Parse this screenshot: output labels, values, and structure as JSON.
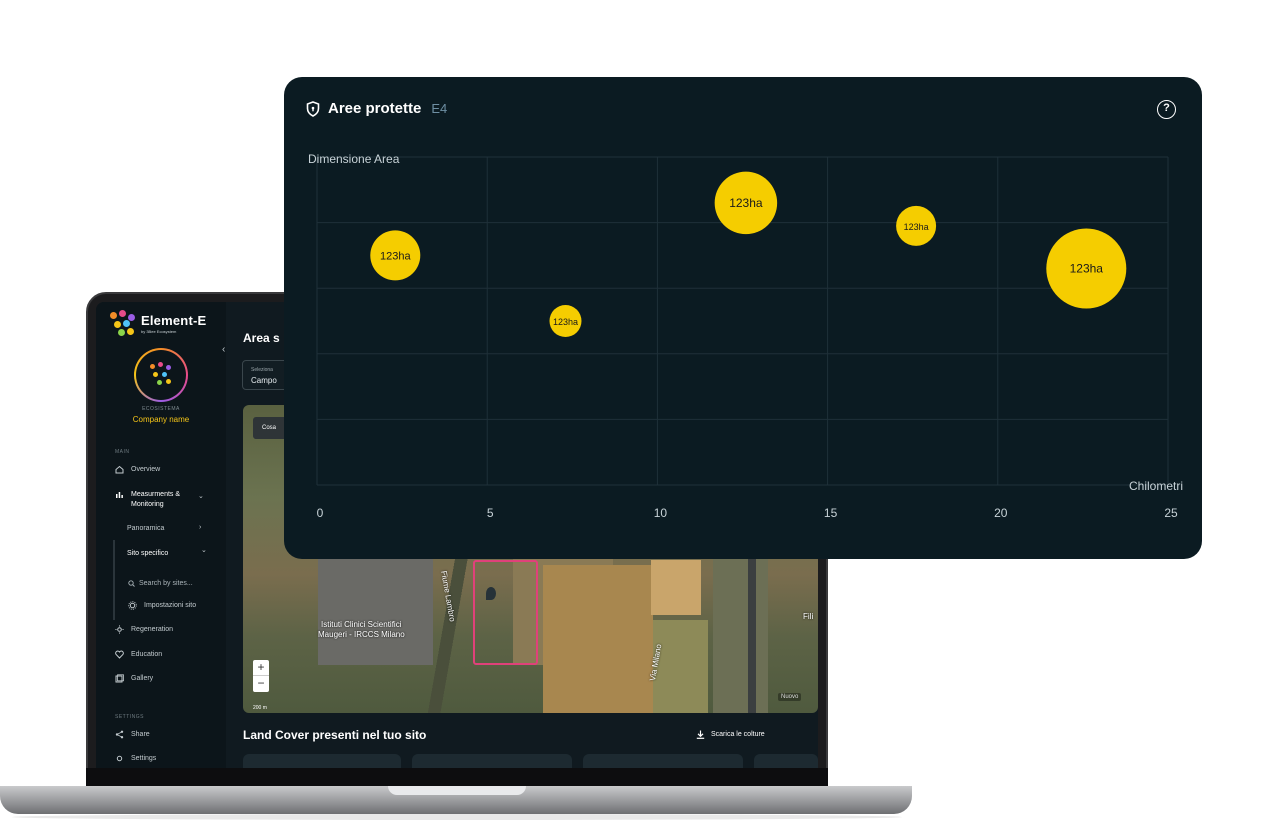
{
  "app": {
    "brand_name": "Element-E",
    "brand_sub": "by 3Bee Ecosystem",
    "eco_label": "ECOSISTEMA",
    "company_name": "Company name"
  },
  "sidebar": {
    "section_main": "MAIN",
    "section_settings": "SETTINGS",
    "items": [
      {
        "label": "Overview",
        "icon": "home-icon"
      },
      {
        "label": "Measurments & Monitoring",
        "icon": "bar-chart-icon"
      },
      {
        "label": "Regeneration",
        "icon": "sun-icon"
      },
      {
        "label": "Education",
        "icon": "heart-icon"
      },
      {
        "label": "Gallery",
        "icon": "gallery-icon"
      }
    ],
    "sub_items": {
      "panoramica": "Panoramica",
      "sito_specifico": "Sito specifico",
      "search": "Search by sites...",
      "impostazioni": "Impostazioni sito"
    },
    "settings_items": [
      {
        "label": "Share",
        "icon": "share-icon"
      },
      {
        "label": "Settings",
        "icon": "gear-icon"
      }
    ]
  },
  "main": {
    "title": "Area s",
    "field": {
      "label": "Seleziona",
      "value": "Campo"
    },
    "map": {
      "chip": "Cosa",
      "labels": [
        "Fiume Lambro",
        "Istituti Clinici Scientifici",
        "Maugeri - IRCCS Milano",
        "Via Milano",
        "Fili"
      ],
      "scale": "200 m",
      "badge": "Nuovo"
    },
    "landcover_title": "Land Cover presenti nel tuo sito",
    "download_label": "Scarica le colture"
  },
  "card": {
    "title": "Aree protette",
    "code": "E4",
    "help_icon": "question-icon",
    "shield_icon": "shield-icon"
  },
  "chart_data": {
    "type": "scatter",
    "title": "Aree protette",
    "ylabel": "Dimensione Area",
    "xlabel": "Chilometri",
    "xlim": [
      0,
      25
    ],
    "x_ticks": [
      "0",
      "5",
      "10",
      "15",
      "20",
      "25"
    ],
    "grid": true,
    "bubble_color": "#f5cd00",
    "points": [
      {
        "x": 2.3,
        "y": 0.7,
        "size": 1.0,
        "label": "123ha"
      },
      {
        "x": 7.3,
        "y": 0.5,
        "size": 0.64,
        "label": "123ha"
      },
      {
        "x": 12.6,
        "y": 0.86,
        "size": 1.25,
        "label": "123ha"
      },
      {
        "x": 17.6,
        "y": 0.79,
        "size": 0.8,
        "label": "123ha"
      },
      {
        "x": 22.6,
        "y": 0.66,
        "size": 1.6,
        "label": "123ha"
      }
    ]
  },
  "colors": {
    "accent": "#f5cd00",
    "card_bg": "#0b1b22",
    "app_bg": "#101a20"
  }
}
